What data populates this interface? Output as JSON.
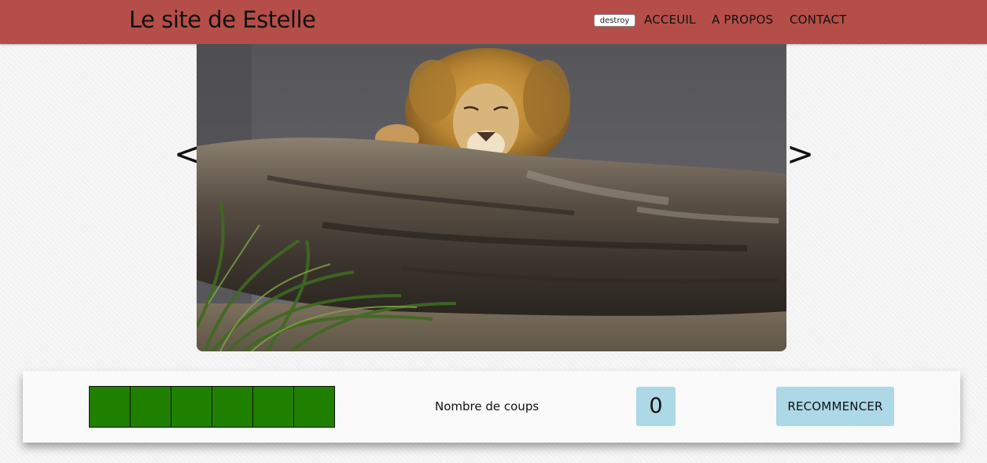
{
  "header": {
    "site_title": "Le site de Estelle",
    "destroy_label": "destroy",
    "nav": {
      "accueil": "ACCEUIL",
      "apropos": "A PROPOS",
      "contact": "CONTACT"
    }
  },
  "carousel": {
    "prev_label": "<",
    "next_label": ">",
    "image_subject": "lion-resting-on-log"
  },
  "game": {
    "card_count": 6,
    "card_color": "#1f8000",
    "coups_label": "Nombre de coups",
    "coups_value": "0",
    "restart_label": "RECOMMENCER"
  },
  "colors": {
    "header": "#b54e48",
    "button": "#add8e6"
  }
}
